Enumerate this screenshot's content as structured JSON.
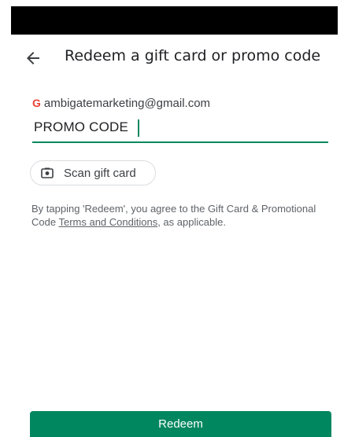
{
  "status_bar": {},
  "header": {
    "back_icon": "arrow-back-icon",
    "title": "Redeem a gift card or promo code"
  },
  "account": {
    "google_icon": "G",
    "email": "ambigatemarketing@gmail.com"
  },
  "code_input": {
    "value": "PROMO CODE"
  },
  "scan_button": {
    "icon": "camera-icon",
    "label": "Scan gift card"
  },
  "terms": {
    "prefix": "By tapping 'Redeem', you agree to the Gift Card & Promotional Code ",
    "link": "Terms and Conditions",
    "suffix": ", as applicable."
  },
  "redeem_button": {
    "label": "Redeem"
  },
  "colors": {
    "accent": "#01875f",
    "google_g": "#EA4335"
  }
}
